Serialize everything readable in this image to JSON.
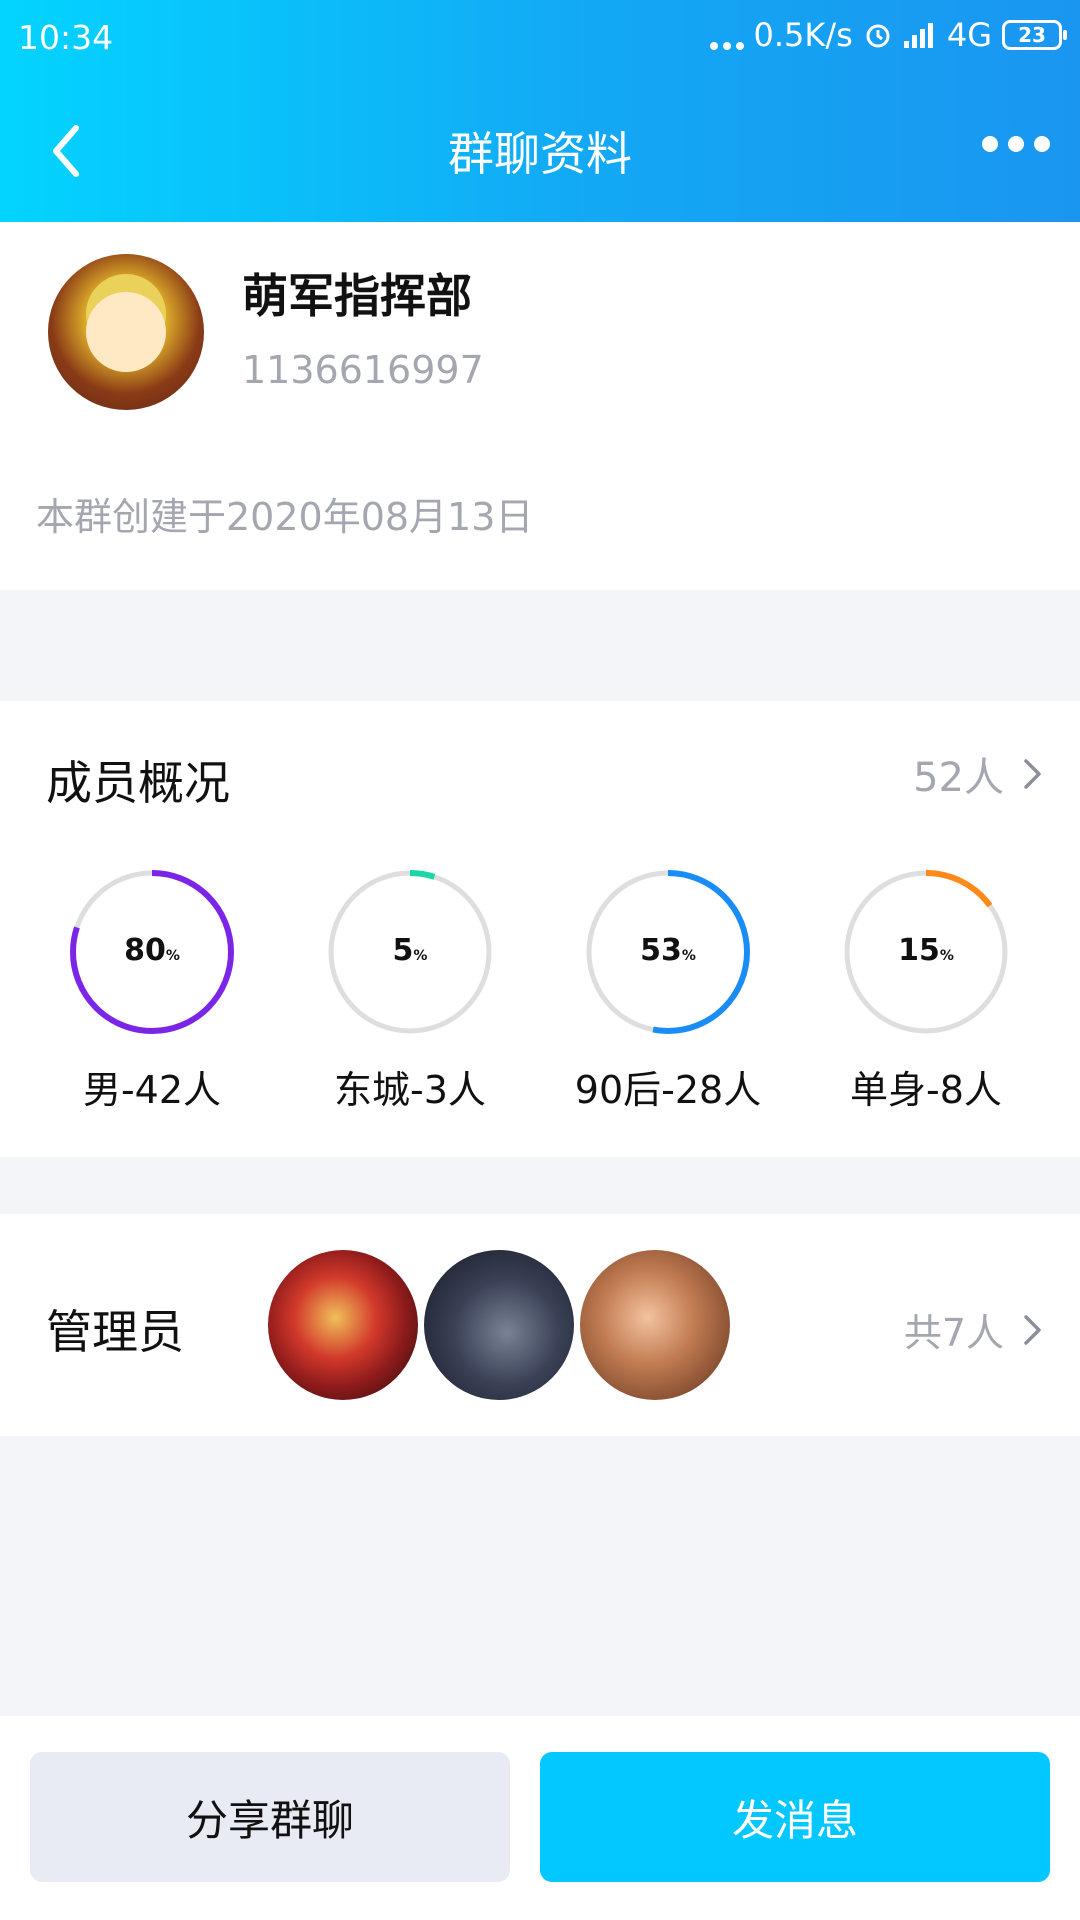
{
  "status_bar": {
    "time": "10:34",
    "speed": "0.5K/s",
    "network": "4G",
    "battery": "23"
  },
  "nav": {
    "title": "群聊资料"
  },
  "group": {
    "name": "萌军指挥部",
    "id": "1136616997",
    "created": "本群创建于2020年08月13日"
  },
  "members": {
    "title": "成员概况",
    "count": "52人",
    "stats": [
      {
        "percent": 80,
        "value_label": "80",
        "unit": "%",
        "label": "男-42人",
        "color": "#7b25e6"
      },
      {
        "percent": 5,
        "value_label": "5",
        "unit": "%",
        "label": "东城-3人",
        "color": "#1dd6a6"
      },
      {
        "percent": 53,
        "value_label": "53",
        "unit": "%",
        "label": "90后-28人",
        "color": "#1a8cf5"
      },
      {
        "percent": 15,
        "value_label": "15",
        "unit": "%",
        "label": "单身-8人",
        "color": "#ff8a1a"
      }
    ]
  },
  "admins": {
    "title": "管理员",
    "count": "共7人"
  },
  "buttons": {
    "share": "分享群聊",
    "send": "发消息"
  },
  "colors": {
    "header_start": "#03d4ff",
    "header_end": "#1a96f1",
    "primary_button": "#03c7ff",
    "ring_track": "#dedede"
  }
}
